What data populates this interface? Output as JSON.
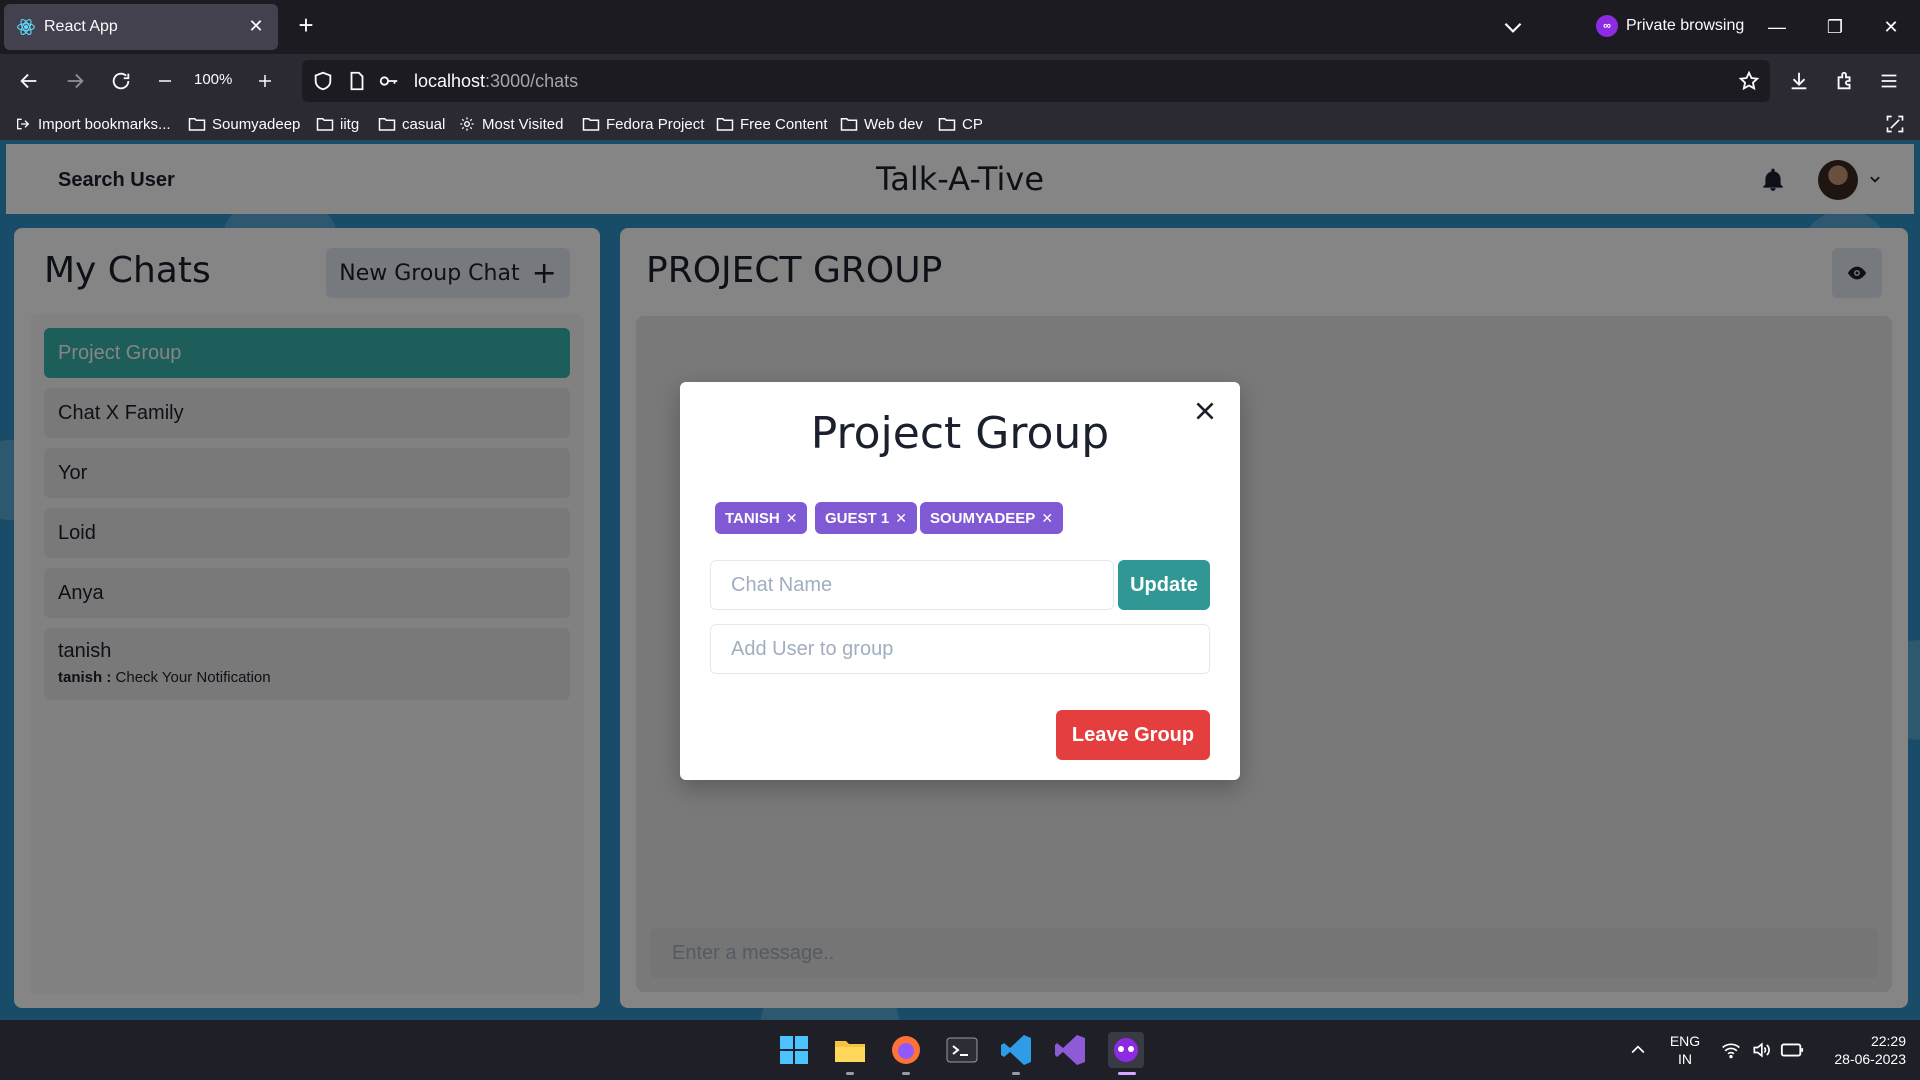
{
  "browser": {
    "tab_title": "React App",
    "private_label": "Private browsing",
    "zoom": "100%",
    "url_host": "localhost",
    "url_path": ":3000/chats",
    "bookmarks": [
      "Import bookmarks...",
      "Soumyadeep",
      "iitg",
      "casual",
      "Most Visited",
      "Fedora Project",
      "Free Content",
      "Web dev",
      "CP"
    ]
  },
  "header": {
    "search_label": "Search User",
    "app_title": "Talk-A-Tive"
  },
  "sidebar": {
    "title": "My Chats",
    "new_group_label": "New Group Chat",
    "chats": [
      {
        "name": "Project Group",
        "active": true
      },
      {
        "name": "Chat X Family"
      },
      {
        "name": "Yor"
      },
      {
        "name": "Loid"
      },
      {
        "name": "Anya"
      },
      {
        "name": "tanish",
        "preview_sender": "tanish : ",
        "preview_text": "Check Your Notification"
      }
    ]
  },
  "chat": {
    "title": "PROJECT GROUP",
    "message_placeholder": "Enter a message.."
  },
  "modal": {
    "title": "Project Group",
    "members": [
      "TANISH",
      "GUEST 1",
      "SOUMYADEEP"
    ],
    "chat_name_placeholder": "Chat Name",
    "update_label": "Update",
    "add_user_placeholder": "Add User to group",
    "leave_label": "Leave Group"
  },
  "taskbar": {
    "lang_top": "ENG",
    "lang_bottom": "IN",
    "time": "22:29",
    "date": "28-06-2023"
  },
  "colors": {
    "accent_teal": "#38b2ac",
    "update_teal": "#319795",
    "badge_purple": "#805ad5",
    "danger_red": "#e53e3e",
    "page_bg_blue": "#2e93c7"
  }
}
